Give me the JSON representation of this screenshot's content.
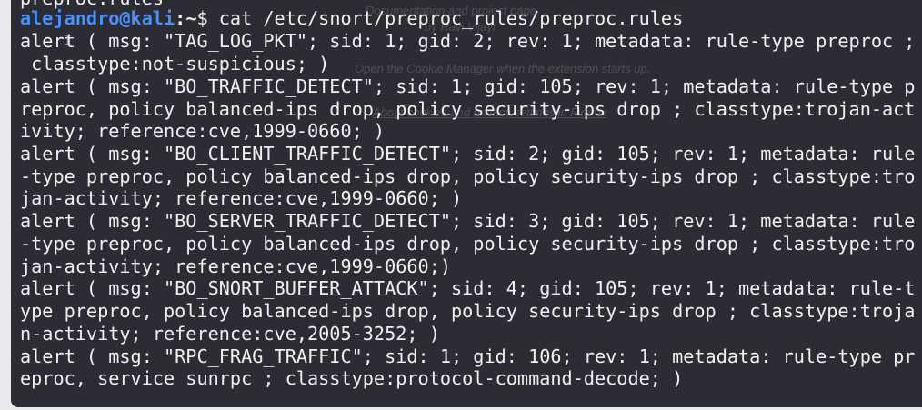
{
  "background_ghost_text": [
    "Documentation and project page",
    "by Ravi Vijayr",
    "Open the Cookie Manager when the extension starts up.",
    "About cookies and privacy settings in Firefox"
  ],
  "terminal": {
    "previous_line": "preproc.rules",
    "prompt": {
      "user_host": "alejandro@kali",
      "separator": ":",
      "path": "~",
      "symbol": "$ ",
      "command": "cat /etc/snort/preproc_rules/preproc.rules"
    },
    "output_lines": [
      "alert ( msg: \"TAG_LOG_PKT\"; sid: 1; gid: 2; rev: 1; metadata: rule-type preproc ;",
      " classtype:not-suspicious; )",
      "alert ( msg: \"BO_TRAFFIC_DETECT\"; sid: 1; gid: 105; rev: 1; metadata: rule-type p",
      "reproc, policy balanced-ips drop, policy security-ips drop ; classtype:trojan-act",
      "ivity; reference:cve,1999-0660; )",
      "alert ( msg: \"BO_CLIENT_TRAFFIC_DETECT\"; sid: 2; gid: 105; rev: 1; metadata: rule",
      "-type preproc, policy balanced-ips drop, policy security-ips drop ; classtype:tro",
      "jan-activity; reference:cve,1999-0660; )",
      "alert ( msg: \"BO_SERVER_TRAFFIC_DETECT\"; sid: 3; gid: 105; rev: 1; metadata: rule",
      "-type preproc, policy balanced-ips drop, policy security-ips drop ; classtype:tro",
      "jan-activity; reference:cve,1999-0660;)",
      "alert ( msg: \"BO_SNORT_BUFFER_ATTACK\"; sid: 4; gid: 105; rev: 1; metadata: rule-t",
      "ype preproc, policy balanced-ips drop, policy security-ips drop ; classtype:troja",
      "n-activity; reference:cve,2005-3252; )",
      "alert ( msg: \"RPC_FRAG_TRAFFIC\"; sid: 1; gid: 106; rev: 1; metadata: rule-type pr",
      "eproc, service sunrpc ; classtype:protocol-command-decode; )"
    ]
  },
  "colors": {
    "terminal_background": "#2c2c35",
    "prompt_user": "#4c8ffb",
    "text": "#f0f0f0"
  }
}
